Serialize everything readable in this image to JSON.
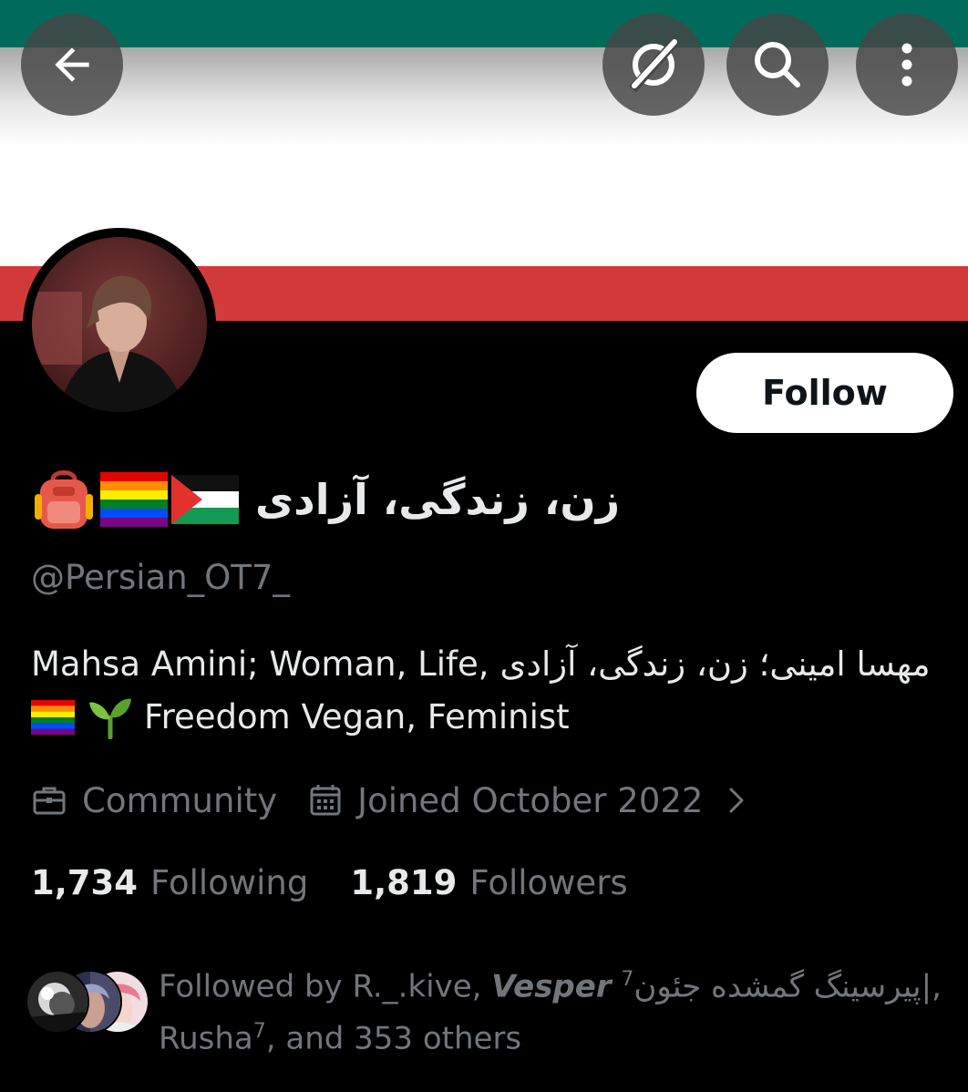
{
  "header": {
    "back_label": "Back",
    "grok_label": "Grok",
    "search_label": "Search",
    "more_label": "More"
  },
  "profile": {
    "display_name": "زن، زندگی، آزادی",
    "name_emojis": [
      "🎒",
      "🏳️‍🌈",
      "🇵🇸"
    ],
    "handle": "@Persian_OT7_",
    "follow_label": "Follow",
    "bio_line1_rtl": "مهسا امینی؛ زن، زندگی، آزادی",
    "bio_line1_en": "Mahsa Amini; Woman, Life,",
    "bio_line2_emojis": "🏳️‍🌈 🌱",
    "bio_line2_text": "Freedom Vegan, Feminist",
    "category": "Community",
    "joined": "Joined October 2022",
    "following_count": "1,734",
    "following_label": "Following",
    "followers_count": "1,819",
    "followers_label": "Followers"
  },
  "followed_by": {
    "prefix": "Followed by R._.kive,",
    "vesper": "Vesper",
    "vesper_sup": "7",
    "persian_name": "|پیرسینگ گمشده جئون",
    "comma": ",",
    "rusha": "Rusha",
    "rusha_sup": "7",
    "suffix": ", and 353 others"
  },
  "colors": {
    "banner_green": "#006b5a",
    "banner_white": "#ffffff",
    "banner_red": "#d23a3a",
    "background": "#000000",
    "text_primary": "#e7e9ea",
    "text_secondary": "#71767b"
  },
  "icons": [
    "back-arrow-icon",
    "grok-icon",
    "search-icon",
    "more-vertical-icon",
    "briefcase-icon",
    "calendar-icon",
    "chevron-right-icon"
  ]
}
